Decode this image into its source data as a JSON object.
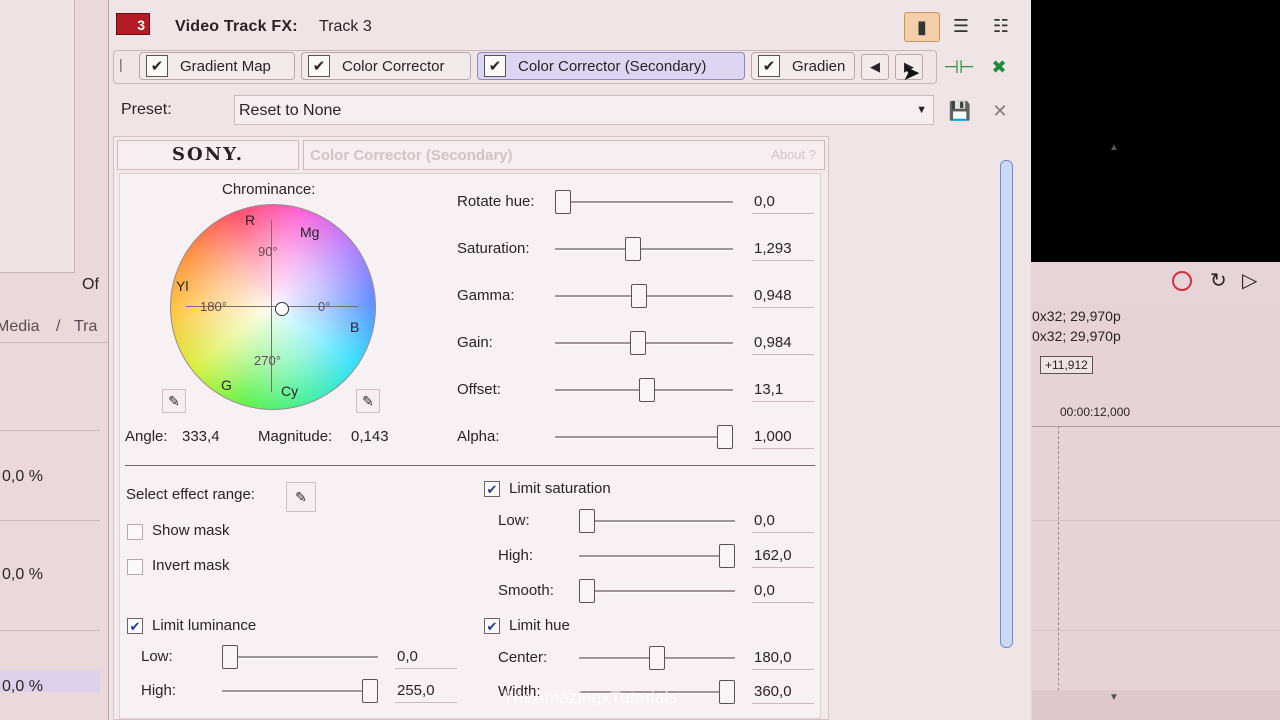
{
  "window": {
    "badge": "3",
    "title_label": "Video Track FX:",
    "title_track": "Track 3"
  },
  "fx_chain": {
    "tabs": [
      {
        "label": "Gradient Map",
        "checked": true
      },
      {
        "label": "Color Corrector",
        "checked": true
      },
      {
        "label": "Color Corrector (Secondary)",
        "checked": true,
        "selected": true
      },
      {
        "label": "Gradien",
        "checked": true
      }
    ]
  },
  "preset": {
    "label": "Preset:",
    "value": "Reset to None"
  },
  "plugin": {
    "vendor": "SONY.",
    "title": "Color Corrector (Secondary)",
    "about": "About ?"
  },
  "chrominance": {
    "label": "Chrominance:",
    "labels": {
      "r": "R",
      "mg": "Mg",
      "b": "B",
      "cy": "Cy",
      "g": "G",
      "yl": "Yl"
    },
    "degrees": {
      "d90": "90°",
      "d180": "180°",
      "d0": "0°",
      "d270": "270°"
    },
    "angle_label": "Angle:",
    "angle_value": "333,4",
    "magnitude_label": "Magnitude:",
    "magnitude_value": "0,143"
  },
  "adjustments": [
    {
      "label": "Rotate hue:",
      "value": "0,0",
      "level": 0.0
    },
    {
      "label": "Saturation:",
      "value": "1,293",
      "level": 0.43
    },
    {
      "label": "Gamma:",
      "value": "0,948",
      "level": 0.47
    },
    {
      "label": "Gain:",
      "value": "0,984",
      "level": 0.46
    },
    {
      "label": "Offset:",
      "value": "13,1",
      "level": 0.52
    },
    {
      "label": "Alpha:",
      "value": "1,000",
      "level": 1.0
    }
  ],
  "effect_range": {
    "label": "Select effect range:",
    "show_mask": {
      "label": "Show mask",
      "checked": false
    },
    "invert_mask": {
      "label": "Invert mask",
      "checked": false
    }
  },
  "limit_saturation": {
    "label": "Limit saturation",
    "checked": true,
    "rows": [
      {
        "label": "Low:",
        "value": "0,0",
        "level": 0.0
      },
      {
        "label": "High:",
        "value": "162,0",
        "level": 1.0
      },
      {
        "label": "Smooth:",
        "value": "0,0",
        "level": 0.0
      }
    ]
  },
  "limit_luminance": {
    "label": "Limit luminance",
    "checked": true,
    "rows": [
      {
        "label": "Low:",
        "value": "0,0",
        "level": 0.0
      },
      {
        "label": "High:",
        "value": "255,0",
        "level": 1.0
      }
    ]
  },
  "limit_hue": {
    "label": "Limit hue",
    "checked": true,
    "rows": [
      {
        "label": "Center:",
        "value": "180,0",
        "level": 0.5
      },
      {
        "label": "Width:",
        "value": "360,0",
        "level": 1.0
      }
    ]
  },
  "background_left": {
    "tab_1": "Media",
    "tab_2": "Tra",
    "of_text": "Of",
    "percents": [
      "0,0 %",
      "0,0 %",
      "0,0 %"
    ]
  },
  "background_right": {
    "line_1": "0x32; 29,970p",
    "line_2": "0x32; 29,970p",
    "pill": "+11,912",
    "timecode": "00:00:12,000"
  },
  "watermark": "TheAmazingxTutorials",
  "colors": {
    "accent_red": "#b51b25",
    "selected_tab": "#ddd6f2",
    "scroll_thumb": "#cbd8f6"
  }
}
